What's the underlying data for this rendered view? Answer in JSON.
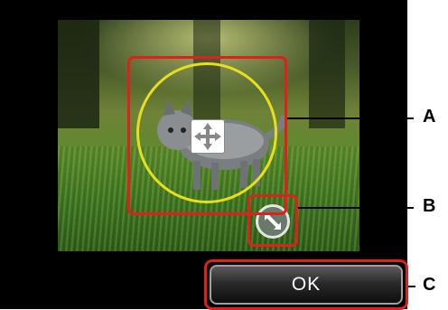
{
  "photo": {
    "description_icon": "cat-photo"
  },
  "controls": {
    "move_icon": "move-arrows-icon",
    "resize_icon": "resize-diagonal-icon",
    "ok_label": "OK"
  },
  "callouts": {
    "a": "A",
    "b": "B",
    "c": "C"
  },
  "colors": {
    "highlight": "#e0201b",
    "crop_circle": "#e8df1c",
    "background": "#000000"
  }
}
